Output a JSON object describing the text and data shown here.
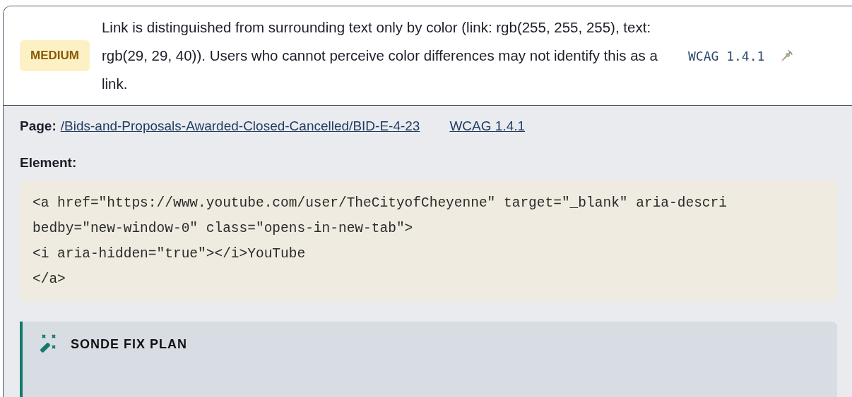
{
  "issue": {
    "severity": {
      "kind": "medium",
      "label": "MEDIUM"
    },
    "description": "Link is distinguished from surrounding text only by color (link: rgb(255, 255, 255), text: rgb(29, 29, 40)). Users who cannot perceive color differences may not identify this as a link.",
    "criterion": "WCAG 1.4.1"
  },
  "details": {
    "page_label": "Page:",
    "page_link": "/Bids-and-Proposals-Awarded-Closed-Cancelled/BID-E-4-23",
    "criterion_link": "WCAG 1.4.1",
    "element_label": "Element:",
    "code_lines": [
      "<a href=\"https://www.youtube.com/user/TheCityofCheyenne\" target=\"_blank\" aria-descri",
      "bedby=\"new-window-0\" class=\"opens-in-new-tab\">",
      "<i aria-hidden=\"true\"></i>YouTube",
      "</a>"
    ]
  },
  "fix_plan": {
    "title": "SONDE FIX PLAN"
  }
}
